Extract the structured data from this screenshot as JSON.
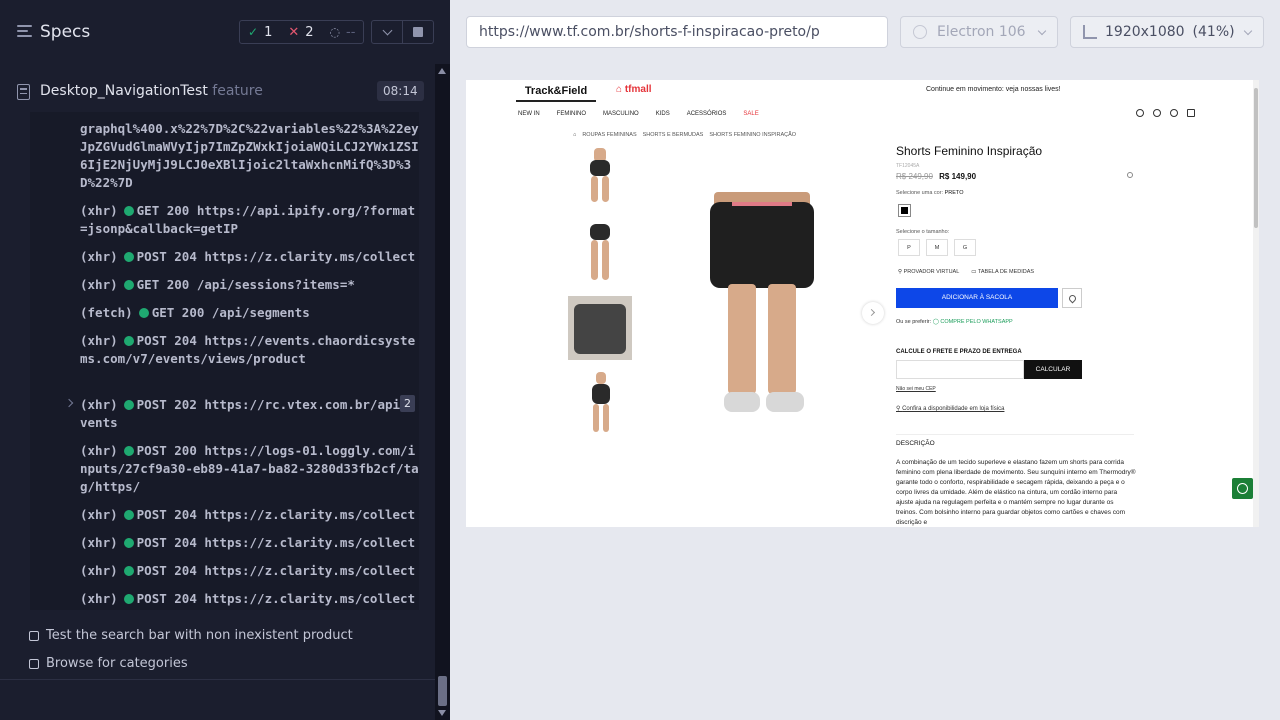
{
  "reporter": {
    "title": "Specs",
    "stats": {
      "passed": "1",
      "failed": "2",
      "pending": "--"
    },
    "spec": {
      "name": "Desktop_NavigationTest",
      "ext": "feature",
      "duration": "08:14"
    },
    "log": [
      {
        "text": "graphql%400.x%22%7D%2C%22variables%22%3A%22eyJpZGVudGlmaWVyIjp7ImZpZWxkIjoiaWQiLCJ2YWx1ZSI6IjE2NjUyMjJ9LCJ0eXBlIjoic2ltaWxhcnMifQ%3D%3D%22%7D"
      },
      {
        "kind": "(xhr)",
        "text": "GET 200 https://api.ipify.org/?format=jsonp&callback=getIP"
      },
      {
        "kind": "(xhr)",
        "text": "POST 204 https://z.clarity.ms/collect"
      },
      {
        "kind": "(xhr)",
        "text": "GET 200 /api/sessions?items=*"
      },
      {
        "kind": "(fetch)",
        "text": "GET 200 /api/segments"
      },
      {
        "kind": "(xhr)",
        "text": "POST 204 https://events.chaordicsystems.com/v7/events/views/product"
      },
      {
        "kind": "(xhr)",
        "text": "POST 202 https://rc.vtex.com.br/api/events",
        "count": "2"
      },
      {
        "kind": "(xhr)",
        "text": "POST 200 https://logs-01.loggly.com/inputs/27cf9a30-eb89-41a7-ba82-3280d33fb2cf/tag/https/"
      },
      {
        "kind": "(xhr)",
        "text": "POST 204 https://z.clarity.ms/collect"
      },
      {
        "kind": "(xhr)",
        "text": "POST 204 https://z.clarity.ms/collect"
      },
      {
        "kind": "(xhr)",
        "text": "POST 204 https://z.clarity.ms/collect"
      },
      {
        "kind": "(xhr)",
        "text": "POST 204 https://z.clarity.ms/collect"
      }
    ],
    "suites": [
      "Test the search bar with non inexistent product",
      "Browse for categories"
    ]
  },
  "aut": {
    "url": "https://www.tf.com.br/shorts-f-inspiracao-preto/p",
    "browser": "Electron 106",
    "viewport": "1920x1080",
    "scale": "(41%)"
  },
  "site": {
    "brand": "Track&Field",
    "mall": "tfmall",
    "banner": "Continue em movimento: veja nossas lives!",
    "menu": [
      "NEW IN",
      "FEMININO",
      "MASCULINO",
      "KIDS",
      "ACESSÓRIOS",
      "SALE"
    ],
    "breadcrumb": [
      "ROUPAS FEMININAS",
      "SHORTS E BERMUDAS",
      "SHORTS FEMININO INSPIRAÇÃO"
    ],
    "product": {
      "title": "Shorts Feminino Inspiração",
      "sku": "TF12045A",
      "old_price": "R$ 249,90",
      "price": "R$ 149,90",
      "color_label": "Selecione uma cor:",
      "color_value": "PRETO",
      "size_label": "Selecione o tamanho:",
      "sizes": [
        "P",
        "M",
        "G"
      ],
      "virtual": "PROVADOR VIRTUAL",
      "measures": "TABELA DE MEDIDAS",
      "add_to_bag": "ADICIONAR À SACOLA",
      "prefer": "Ou se preferir:",
      "whatsapp": "COMPRE PELO WHATSAPP",
      "shipping_label": "CALCULE O FRETE E PRAZO DE ENTREGA",
      "calc": "CALCULAR",
      "no_cep": "Não sei meu CEP",
      "store": "Confira a disponibilidade em loja física",
      "desc_label": "DESCRIÇÃO",
      "description": "A combinação de um tecido superleve e elastano fazem um shorts para corrida feminino com plena liberdade de movimento. Seu sunquíni interno em Thermodry® garante todo o conforto, respirabilidade e secagem rápida, deixando a peça e o corpo livres da umidade. Além de elástico na cintura, um cordão interno para ajuste ajuda na regulagem perfeita e o mantém sempre no lugar durante os treinos. Com bolsinho interno para guardar objetos como cartões e chaves com discrição e"
    }
  }
}
